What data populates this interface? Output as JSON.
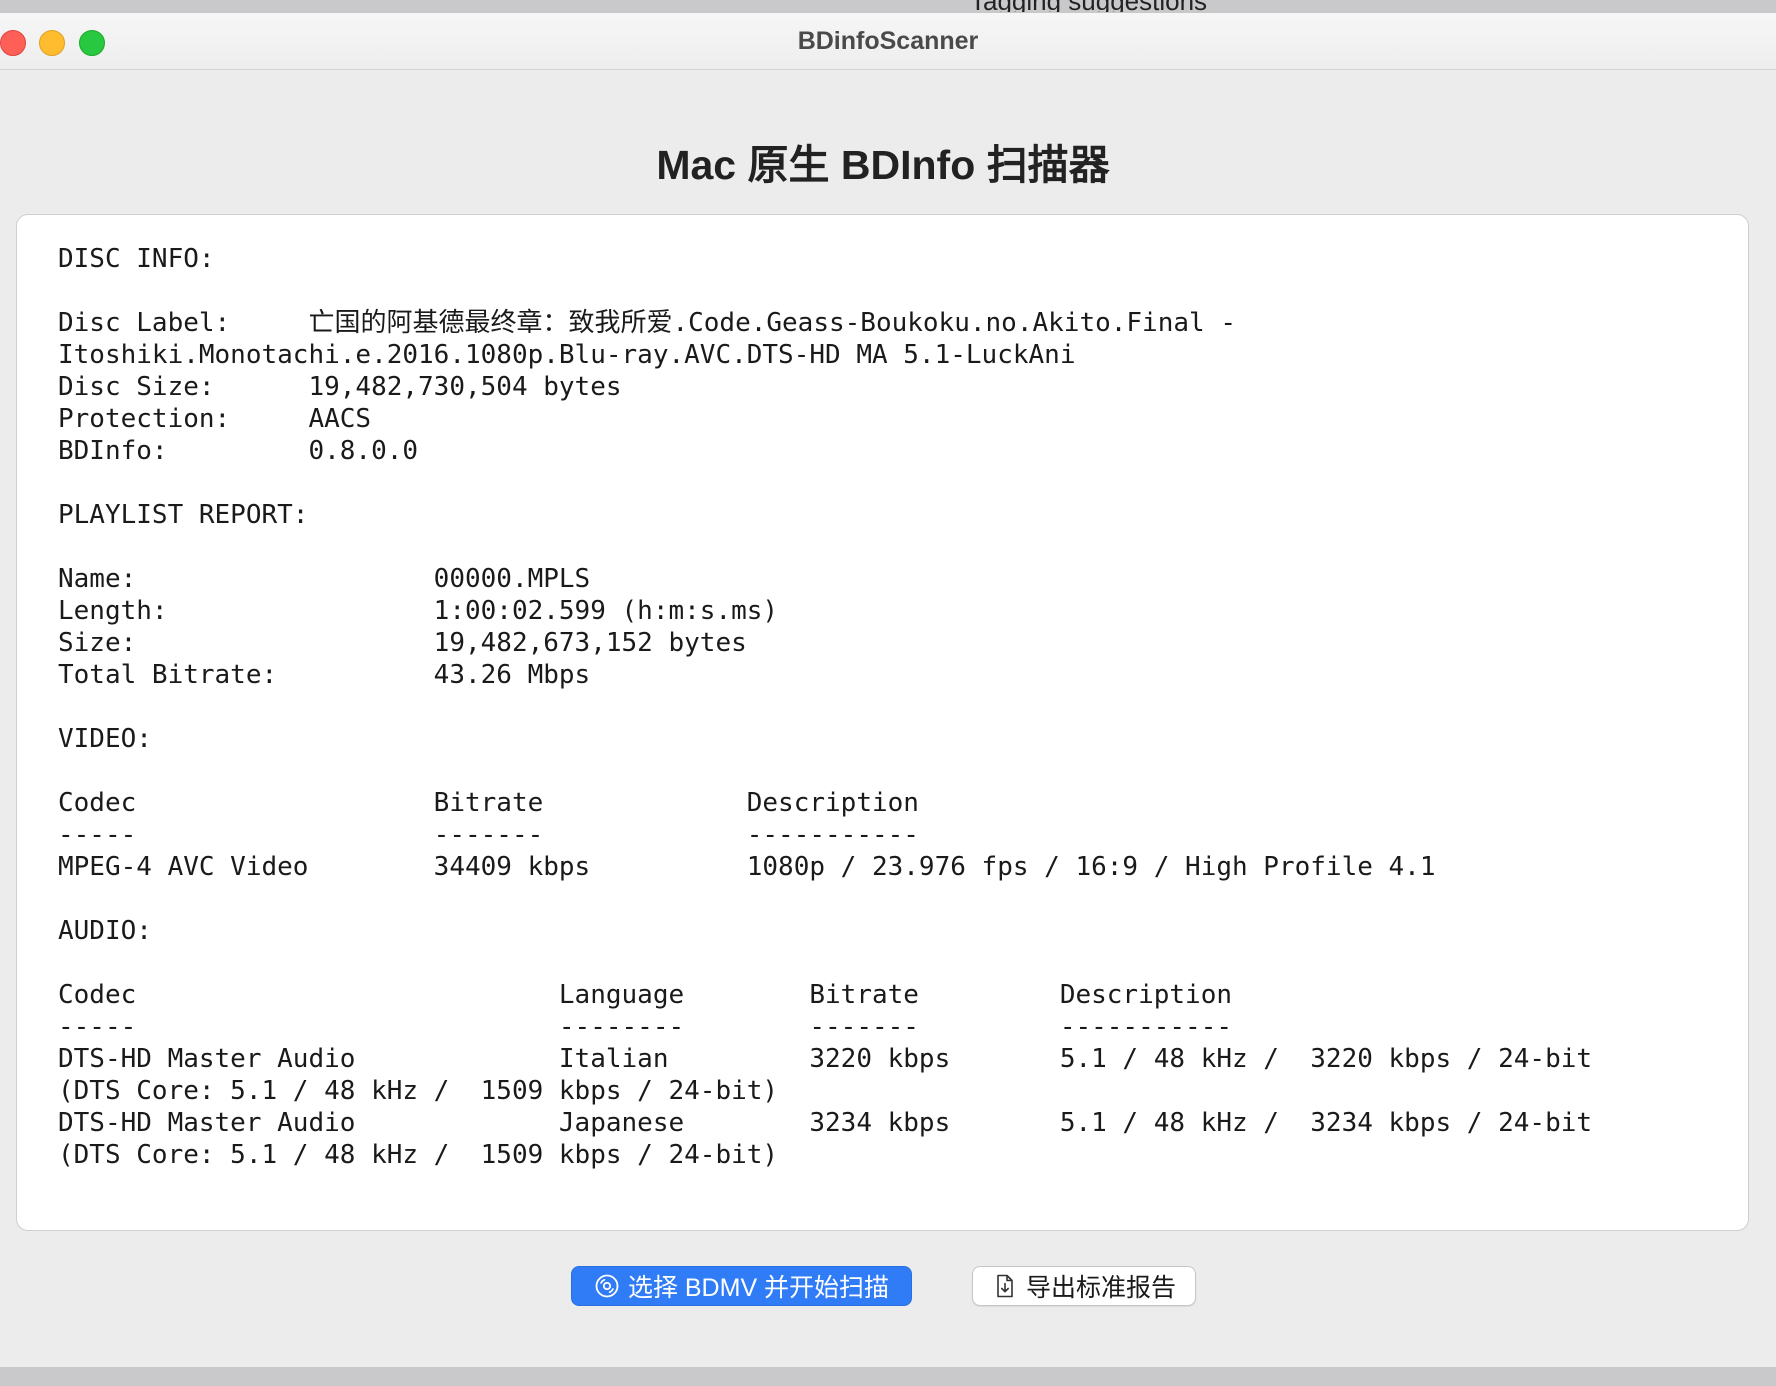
{
  "background_window": {
    "text": "Tagging suggestions"
  },
  "window": {
    "title": "BDinfoScanner"
  },
  "page": {
    "heading": "Mac 原生 BDInfo 扫描器"
  },
  "report": {
    "text": "DISC INFO:\n\nDisc Label:     亡国的阿基德最终章：致我所爱.Code.Geass-Boukoku.no.Akito.Final -\nItoshiki.Monotachi.e.2016.1080p.Blu-ray.AVC.DTS-HD MA 5.1-LuckAni\nDisc Size:      19,482,730,504 bytes\nProtection:     AACS\nBDInfo:         0.8.0.0\n\nPLAYLIST REPORT:\n\nName:                   00000.MPLS\nLength:                 1:00:02.599 (h:m:s.ms)\nSize:                   19,482,673,152 bytes\nTotal Bitrate:          43.26 Mbps\n\nVIDEO:\n\nCodec                   Bitrate             Description\n-----                   -------             -----------\nMPEG-4 AVC Video        34409 kbps          1080p / 23.976 fps / 16:9 / High Profile 4.1\n\nAUDIO:\n\nCodec                           Language        Bitrate         Description\n-----                           --------        -------         -----------\nDTS-HD Master Audio             Italian         3220 kbps       5.1 / 48 kHz /  3220 kbps / 24-bit\n(DTS Core: 5.1 / 48 kHz /  1509 kbps / 24-bit)\nDTS-HD Master Audio             Japanese        3234 kbps       5.1 / 48 kHz /  3234 kbps / 24-bit\n(DTS Core: 5.1 / 48 kHz /  1509 kbps / 24-bit)"
  },
  "buttons": {
    "scan_label": "选择 BDMV 并开始扫描",
    "scan_icon": "disc-icon",
    "export_label": "导出标准报告",
    "export_icon": "document-download-icon"
  },
  "colors": {
    "accent": "#2f7cf6",
    "close": "#fe5f57",
    "minimize": "#febc2e",
    "zoom": "#28c840"
  }
}
